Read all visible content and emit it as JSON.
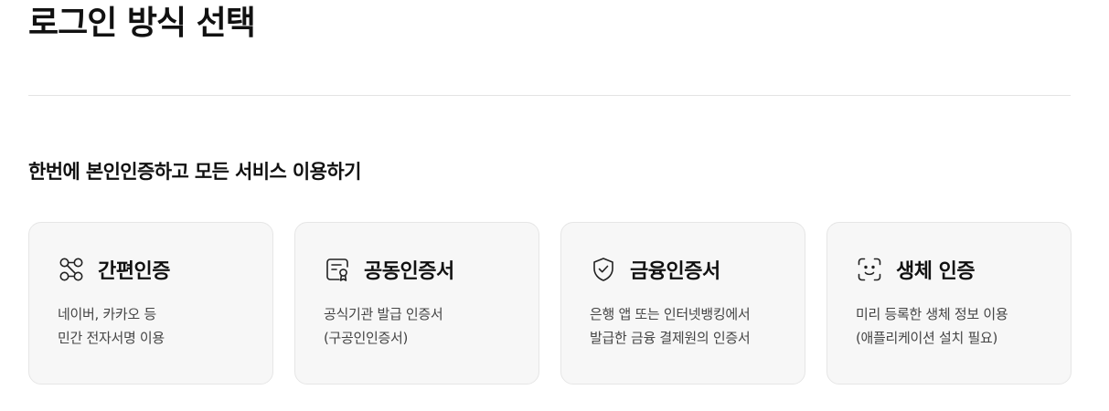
{
  "page": {
    "title": "로그인 방식 선택"
  },
  "section": {
    "title": "한번에 본인인증하고 모든 서비스 이용하기"
  },
  "cards": [
    {
      "icon": "link-nodes-icon",
      "title": "간편인증",
      "desc_line1": "네이버, 카카오 등",
      "desc_line2": "민간 전자서명 이용"
    },
    {
      "icon": "certificate-icon",
      "title": "공동인증서",
      "desc_line1": "공식기관 발급 인증서",
      "desc_line2": "(구공인인증서)"
    },
    {
      "icon": "shield-check-icon",
      "title": "금융인증서",
      "desc_line1": "은행 앱 또는 인터넷뱅킹에서",
      "desc_line2": "발급한 금융 결제원의 인증서"
    },
    {
      "icon": "face-scan-icon",
      "title": "생체 인증",
      "desc_line1": "미리 등록한 생체 정보 이용",
      "desc_line2": "(애플리케이션 설치 필요)"
    }
  ]
}
